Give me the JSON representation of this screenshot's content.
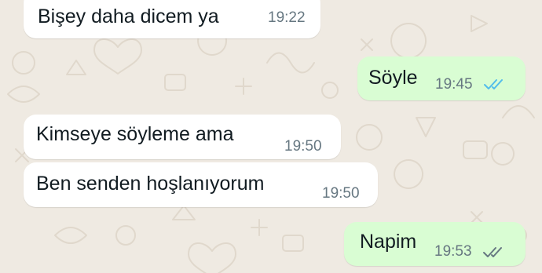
{
  "chat": {
    "messages": [
      {
        "direction": "incoming",
        "text": "Bişey daha dicem ya",
        "time": "19:22"
      },
      {
        "direction": "outgoing",
        "text": "Söyle",
        "time": "19:45",
        "status": "read",
        "tick_icon": "double-check-icon",
        "tick_color": "#53bdeb"
      },
      {
        "direction": "incoming",
        "text": "Kimseye söyleme ama",
        "time": "19:50"
      },
      {
        "direction": "incoming",
        "text": "Ben senden hoşlanıyorum",
        "time": "19:50"
      },
      {
        "direction": "outgoing",
        "text": "Napim",
        "time": "19:53",
        "status": "delivered",
        "tick_icon": "double-check-icon",
        "tick_color": "#667781"
      }
    ]
  },
  "colors": {
    "background": "#efeae2",
    "incoming_bubble": "#ffffff",
    "outgoing_bubble": "#d9fdd3",
    "text": "#111b21",
    "time": "#667781"
  }
}
